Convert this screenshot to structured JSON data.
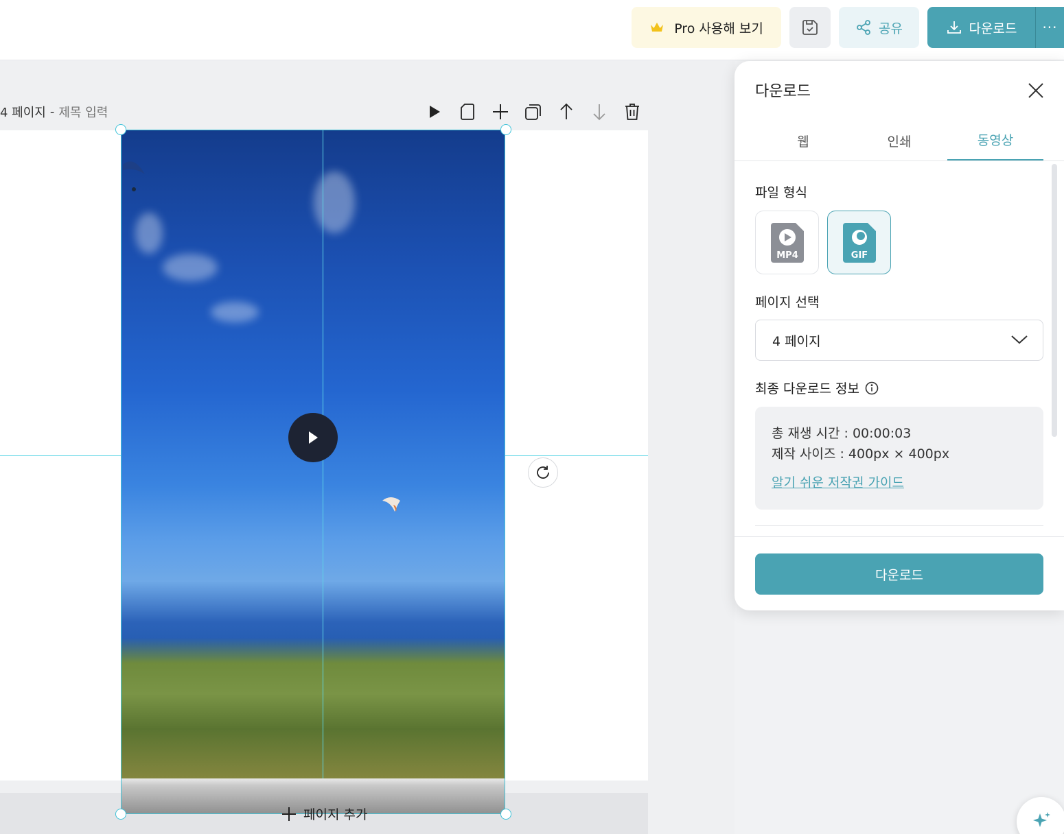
{
  "header": {
    "pro_label": "Pro 사용해 보기",
    "share_label": "공유",
    "download_label": "다운로드",
    "more_label": "···"
  },
  "page": {
    "number_label": "4 페이지",
    "separator": "-",
    "title_placeholder": "제목 입력",
    "add_page_label": "페이지 추가"
  },
  "panel": {
    "title": "다운로드",
    "tabs": [
      {
        "label": "웹"
      },
      {
        "label": "인쇄"
      },
      {
        "label": "동영상"
      }
    ],
    "active_tab": "동영상",
    "file_format_label": "파일 형식",
    "formats": [
      {
        "label": "MP4",
        "selected": false
      },
      {
        "label": "GIF",
        "selected": true
      }
    ],
    "page_select_label": "페이지 선택",
    "page_select_value": "4 페이지",
    "final_info_label": "최종 다운로드 정보",
    "info": {
      "duration": "총 재생 시간 : 00:00:03",
      "size": "제작 사이즈 : 400px × 400px",
      "guide_link": "알기 쉬운 저작권 가이드"
    },
    "download_button": "다운로드"
  },
  "colors": {
    "accent": "#4aa3b3",
    "pro_bg": "#fdf8e2",
    "crown": "#f2c21b",
    "selection": "#3fc3d9"
  }
}
